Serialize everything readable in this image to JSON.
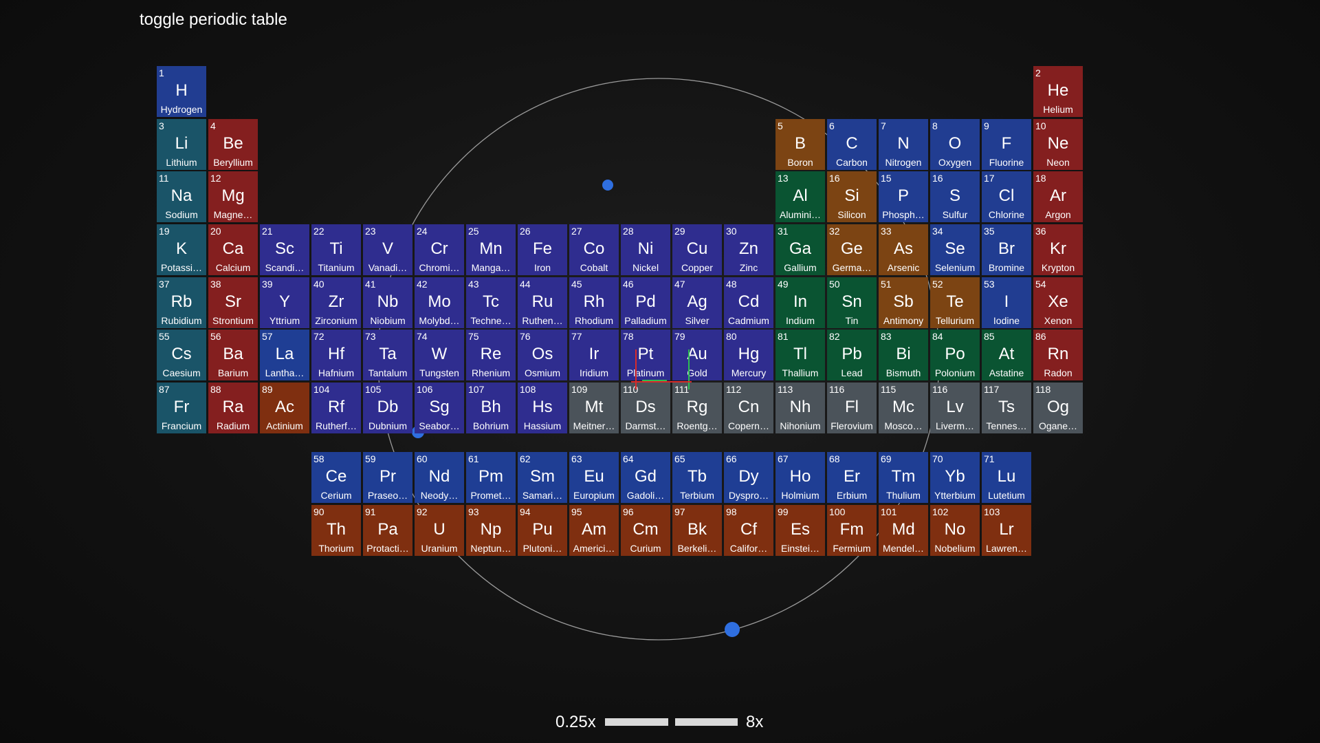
{
  "toggle_label": "toggle periodic table",
  "zoom": {
    "min_label": "0.25x",
    "max_label": "8x"
  },
  "colors": {
    "alkali": "#1a5468",
    "alkaline_earth": "#841f1f",
    "transition": "#2f2d8f",
    "lanthanide": "#1f3e94",
    "actinide": "#7f2f10",
    "metalloid": "#7c4413",
    "post_transition": "#0a5432",
    "nonmetal": "#213d91",
    "noble_gas": "#841f1f",
    "unknown": "#4b535a",
    "hydrogen": "#213d91",
    "orbit_line": "#9a9a9a",
    "electron": "#2f6fe0"
  },
  "elements": [
    {
      "n": "1",
      "s": "H",
      "name": "Hydrogen",
      "row": 1,
      "col": 1,
      "cat": "hydrogen"
    },
    {
      "n": "2",
      "s": "He",
      "name": "Helium",
      "row": 1,
      "col": 18,
      "cat": "noble_gas"
    },
    {
      "n": "3",
      "s": "Li",
      "name": "Lithium",
      "row": 2,
      "col": 1,
      "cat": "alkali"
    },
    {
      "n": "4",
      "s": "Be",
      "name": "Beryllium",
      "row": 2,
      "col": 2,
      "cat": "alkaline_earth"
    },
    {
      "n": "5",
      "s": "B",
      "name": "Boron",
      "row": 2,
      "col": 13,
      "cat": "metalloid"
    },
    {
      "n": "6",
      "s": "C",
      "name": "Carbon",
      "row": 2,
      "col": 14,
      "cat": "nonmetal"
    },
    {
      "n": "7",
      "s": "N",
      "name": "Nitrogen",
      "row": 2,
      "col": 15,
      "cat": "nonmetal"
    },
    {
      "n": "8",
      "s": "O",
      "name": "Oxygen",
      "row": 2,
      "col": 16,
      "cat": "nonmetal"
    },
    {
      "n": "9",
      "s": "F",
      "name": "Fluorine",
      "row": 2,
      "col": 17,
      "cat": "nonmetal"
    },
    {
      "n": "10",
      "s": "Ne",
      "name": "Neon",
      "row": 2,
      "col": 18,
      "cat": "noble_gas"
    },
    {
      "n": "11",
      "s": "Na",
      "name": "Sodium",
      "row": 3,
      "col": 1,
      "cat": "alkali"
    },
    {
      "n": "12",
      "s": "Mg",
      "name": "Magne…",
      "row": 3,
      "col": 2,
      "cat": "alkaline_earth"
    },
    {
      "n": "13",
      "s": "Al",
      "name": "Alumini…",
      "row": 3,
      "col": 13,
      "cat": "post_transition"
    },
    {
      "n": "16",
      "s": "Si",
      "name": "Silicon",
      "row": 3,
      "col": 14,
      "cat": "metalloid"
    },
    {
      "n": "15",
      "s": "P",
      "name": "Phosph…",
      "row": 3,
      "col": 15,
      "cat": "nonmetal"
    },
    {
      "n": "16",
      "s": "S",
      "name": "Sulfur",
      "row": 3,
      "col": 16,
      "cat": "nonmetal"
    },
    {
      "n": "17",
      "s": "Cl",
      "name": "Chlorine",
      "row": 3,
      "col": 17,
      "cat": "nonmetal"
    },
    {
      "n": "18",
      "s": "Ar",
      "name": "Argon",
      "row": 3,
      "col": 18,
      "cat": "noble_gas"
    },
    {
      "n": "19",
      "s": "K",
      "name": "Potassi…",
      "row": 4,
      "col": 1,
      "cat": "alkali"
    },
    {
      "n": "20",
      "s": "Ca",
      "name": "Calcium",
      "row": 4,
      "col": 2,
      "cat": "alkaline_earth"
    },
    {
      "n": "21",
      "s": "Sc",
      "name": "Scandi…",
      "row": 4,
      "col": 3,
      "cat": "transition"
    },
    {
      "n": "22",
      "s": "Ti",
      "name": "Titanium",
      "row": 4,
      "col": 4,
      "cat": "transition"
    },
    {
      "n": "23",
      "s": "V",
      "name": "Vanadi…",
      "row": 4,
      "col": 5,
      "cat": "transition"
    },
    {
      "n": "24",
      "s": "Cr",
      "name": "Chromi…",
      "row": 4,
      "col": 6,
      "cat": "transition"
    },
    {
      "n": "25",
      "s": "Mn",
      "name": "Manga…",
      "row": 4,
      "col": 7,
      "cat": "transition"
    },
    {
      "n": "26",
      "s": "Fe",
      "name": "Iron",
      "row": 4,
      "col": 8,
      "cat": "transition"
    },
    {
      "n": "27",
      "s": "Co",
      "name": "Cobalt",
      "row": 4,
      "col": 9,
      "cat": "transition"
    },
    {
      "n": "28",
      "s": "Ni",
      "name": "Nickel",
      "row": 4,
      "col": 10,
      "cat": "transition"
    },
    {
      "n": "29",
      "s": "Cu",
      "name": "Copper",
      "row": 4,
      "col": 11,
      "cat": "transition"
    },
    {
      "n": "30",
      "s": "Zn",
      "name": "Zinc",
      "row": 4,
      "col": 12,
      "cat": "transition"
    },
    {
      "n": "31",
      "s": "Ga",
      "name": "Gallium",
      "row": 4,
      "col": 13,
      "cat": "post_transition"
    },
    {
      "n": "32",
      "s": "Ge",
      "name": "Germa…",
      "row": 4,
      "col": 14,
      "cat": "metalloid"
    },
    {
      "n": "33",
      "s": "As",
      "name": "Arsenic",
      "row": 4,
      "col": 15,
      "cat": "metalloid"
    },
    {
      "n": "34",
      "s": "Se",
      "name": "Selenium",
      "row": 4,
      "col": 16,
      "cat": "nonmetal"
    },
    {
      "n": "35",
      "s": "Br",
      "name": "Bromine",
      "row": 4,
      "col": 17,
      "cat": "nonmetal"
    },
    {
      "n": "36",
      "s": "Kr",
      "name": "Krypton",
      "row": 4,
      "col": 18,
      "cat": "noble_gas"
    },
    {
      "n": "37",
      "s": "Rb",
      "name": "Rubidium",
      "row": 5,
      "col": 1,
      "cat": "alkali"
    },
    {
      "n": "38",
      "s": "Sr",
      "name": "Strontium",
      "row": 5,
      "col": 2,
      "cat": "alkaline_earth"
    },
    {
      "n": "39",
      "s": "Y",
      "name": "Yttrium",
      "row": 5,
      "col": 3,
      "cat": "transition"
    },
    {
      "n": "40",
      "s": "Zr",
      "name": "Zirconium",
      "row": 5,
      "col": 4,
      "cat": "transition"
    },
    {
      "n": "41",
      "s": "Nb",
      "name": "Niobium",
      "row": 5,
      "col": 5,
      "cat": "transition"
    },
    {
      "n": "42",
      "s": "Mo",
      "name": "Molybd…",
      "row": 5,
      "col": 6,
      "cat": "transition"
    },
    {
      "n": "43",
      "s": "Tc",
      "name": "Techne…",
      "row": 5,
      "col": 7,
      "cat": "transition"
    },
    {
      "n": "44",
      "s": "Ru",
      "name": "Ruthen…",
      "row": 5,
      "col": 8,
      "cat": "transition"
    },
    {
      "n": "45",
      "s": "Rh",
      "name": "Rhodium",
      "row": 5,
      "col": 9,
      "cat": "transition"
    },
    {
      "n": "46",
      "s": "Pd",
      "name": "Palladium",
      "row": 5,
      "col": 10,
      "cat": "transition"
    },
    {
      "n": "47",
      "s": "Ag",
      "name": "Silver",
      "row": 5,
      "col": 11,
      "cat": "transition"
    },
    {
      "n": "48",
      "s": "Cd",
      "name": "Cadmium",
      "row": 5,
      "col": 12,
      "cat": "transition"
    },
    {
      "n": "49",
      "s": "In",
      "name": "Indium",
      "row": 5,
      "col": 13,
      "cat": "post_transition"
    },
    {
      "n": "50",
      "s": "Sn",
      "name": "Tin",
      "row": 5,
      "col": 14,
      "cat": "post_transition"
    },
    {
      "n": "51",
      "s": "Sb",
      "name": "Antimony",
      "row": 5,
      "col": 15,
      "cat": "metalloid"
    },
    {
      "n": "52",
      "s": "Te",
      "name": "Tellurium",
      "row": 5,
      "col": 16,
      "cat": "metalloid"
    },
    {
      "n": "53",
      "s": "I",
      "name": "Iodine",
      "row": 5,
      "col": 17,
      "cat": "nonmetal"
    },
    {
      "n": "54",
      "s": "Xe",
      "name": "Xenon",
      "row": 5,
      "col": 18,
      "cat": "noble_gas"
    },
    {
      "n": "55",
      "s": "Cs",
      "name": "Caesium",
      "row": 6,
      "col": 1,
      "cat": "alkali"
    },
    {
      "n": "56",
      "s": "Ba",
      "name": "Barium",
      "row": 6,
      "col": 2,
      "cat": "alkaline_earth"
    },
    {
      "n": "57",
      "s": "La",
      "name": "Lantha…",
      "row": 6,
      "col": 3,
      "cat": "lanthanide"
    },
    {
      "n": "72",
      "s": "Hf",
      "name": "Hafnium",
      "row": 6,
      "col": 4,
      "cat": "transition"
    },
    {
      "n": "73",
      "s": "Ta",
      "name": "Tantalum",
      "row": 6,
      "col": 5,
      "cat": "transition"
    },
    {
      "n": "74",
      "s": "W",
      "name": "Tungsten",
      "row": 6,
      "col": 6,
      "cat": "transition"
    },
    {
      "n": "75",
      "s": "Re",
      "name": "Rhenium",
      "row": 6,
      "col": 7,
      "cat": "transition"
    },
    {
      "n": "76",
      "s": "Os",
      "name": "Osmium",
      "row": 6,
      "col": 8,
      "cat": "transition"
    },
    {
      "n": "77",
      "s": "Ir",
      "name": "Iridium",
      "row": 6,
      "col": 9,
      "cat": "transition"
    },
    {
      "n": "78",
      "s": "Pt",
      "name": "Platinum",
      "row": 6,
      "col": 10,
      "cat": "transition"
    },
    {
      "n": "79",
      "s": "Au",
      "name": "Gold",
      "row": 6,
      "col": 11,
      "cat": "transition"
    },
    {
      "n": "80",
      "s": "Hg",
      "name": "Mercury",
      "row": 6,
      "col": 12,
      "cat": "transition"
    },
    {
      "n": "81",
      "s": "Tl",
      "name": "Thallium",
      "row": 6,
      "col": 13,
      "cat": "post_transition"
    },
    {
      "n": "82",
      "s": "Pb",
      "name": "Lead",
      "row": 6,
      "col": 14,
      "cat": "post_transition"
    },
    {
      "n": "83",
      "s": "Bi",
      "name": "Bismuth",
      "row": 6,
      "col": 15,
      "cat": "post_transition"
    },
    {
      "n": "84",
      "s": "Po",
      "name": "Polonium",
      "row": 6,
      "col": 16,
      "cat": "post_transition"
    },
    {
      "n": "85",
      "s": "At",
      "name": "Astatine",
      "row": 6,
      "col": 17,
      "cat": "post_transition"
    },
    {
      "n": "86",
      "s": "Rn",
      "name": "Radon",
      "row": 6,
      "col": 18,
      "cat": "noble_gas"
    },
    {
      "n": "87",
      "s": "Fr",
      "name": "Francium",
      "row": 7,
      "col": 1,
      "cat": "alkali"
    },
    {
      "n": "88",
      "s": "Ra",
      "name": "Radium",
      "row": 7,
      "col": 2,
      "cat": "alkaline_earth"
    },
    {
      "n": "89",
      "s": "Ac",
      "name": "Actinium",
      "row": 7,
      "col": 3,
      "cat": "actinide"
    },
    {
      "n": "104",
      "s": "Rf",
      "name": "Rutherf…",
      "row": 7,
      "col": 4,
      "cat": "transition"
    },
    {
      "n": "105",
      "s": "Db",
      "name": "Dubnium",
      "row": 7,
      "col": 5,
      "cat": "transition"
    },
    {
      "n": "106",
      "s": "Sg",
      "name": "Seabor…",
      "row": 7,
      "col": 6,
      "cat": "transition"
    },
    {
      "n": "107",
      "s": "Bh",
      "name": "Bohrium",
      "row": 7,
      "col": 7,
      "cat": "transition"
    },
    {
      "n": "108",
      "s": "Hs",
      "name": "Hassium",
      "row": 7,
      "col": 8,
      "cat": "transition"
    },
    {
      "n": "109",
      "s": "Mt",
      "name": "Meitner…",
      "row": 7,
      "col": 9,
      "cat": "unknown"
    },
    {
      "n": "110",
      "s": "Ds",
      "name": "Darmst…",
      "row": 7,
      "col": 10,
      "cat": "unknown"
    },
    {
      "n": "111",
      "s": "Rg",
      "name": "Roentg…",
      "row": 7,
      "col": 11,
      "cat": "unknown"
    },
    {
      "n": "112",
      "s": "Cn",
      "name": "Copern…",
      "row": 7,
      "col": 12,
      "cat": "unknown"
    },
    {
      "n": "113",
      "s": "Nh",
      "name": "Nihonium",
      "row": 7,
      "col": 13,
      "cat": "unknown"
    },
    {
      "n": "116",
      "s": "Fl",
      "name": "Flerovium",
      "row": 7,
      "col": 14,
      "cat": "unknown"
    },
    {
      "n": "115",
      "s": "Mc",
      "name": "Mosco…",
      "row": 7,
      "col": 15,
      "cat": "unknown"
    },
    {
      "n": "116",
      "s": "Lv",
      "name": "Liverm…",
      "row": 7,
      "col": 16,
      "cat": "unknown"
    },
    {
      "n": "117",
      "s": "Ts",
      "name": "Tennes…",
      "row": 7,
      "col": 17,
      "cat": "unknown"
    },
    {
      "n": "118",
      "s": "Og",
      "name": "Ogane…",
      "row": 7,
      "col": 18,
      "cat": "unknown"
    },
    {
      "n": "58",
      "s": "Ce",
      "name": "Cerium",
      "row": 9,
      "col": 4,
      "cat": "lanthanide"
    },
    {
      "n": "59",
      "s": "Pr",
      "name": "Praseo…",
      "row": 9,
      "col": 5,
      "cat": "lanthanide"
    },
    {
      "n": "60",
      "s": "Nd",
      "name": "Neody…",
      "row": 9,
      "col": 6,
      "cat": "lanthanide"
    },
    {
      "n": "61",
      "s": "Pm",
      "name": "Promet…",
      "row": 9,
      "col": 7,
      "cat": "lanthanide"
    },
    {
      "n": "62",
      "s": "Sm",
      "name": "Samari…",
      "row": 9,
      "col": 8,
      "cat": "lanthanide"
    },
    {
      "n": "63",
      "s": "Eu",
      "name": "Europium",
      "row": 9,
      "col": 9,
      "cat": "lanthanide"
    },
    {
      "n": "64",
      "s": "Gd",
      "name": "Gadoli…",
      "row": 9,
      "col": 10,
      "cat": "lanthanide"
    },
    {
      "n": "65",
      "s": "Tb",
      "name": "Terbium",
      "row": 9,
      "col": 11,
      "cat": "lanthanide"
    },
    {
      "n": "66",
      "s": "Dy",
      "name": "Dyspro…",
      "row": 9,
      "col": 12,
      "cat": "lanthanide"
    },
    {
      "n": "67",
      "s": "Ho",
      "name": "Holmium",
      "row": 9,
      "col": 13,
      "cat": "lanthanide"
    },
    {
      "n": "68",
      "s": "Er",
      "name": "Erbium",
      "row": 9,
      "col": 14,
      "cat": "lanthanide"
    },
    {
      "n": "69",
      "s": "Tm",
      "name": "Thulium",
      "row": 9,
      "col": 15,
      "cat": "lanthanide"
    },
    {
      "n": "70",
      "s": "Yb",
      "name": "Ytterbium",
      "row": 9,
      "col": 16,
      "cat": "lanthanide"
    },
    {
      "n": "71",
      "s": "Lu",
      "name": "Lutetium",
      "row": 9,
      "col": 17,
      "cat": "lanthanide"
    },
    {
      "n": "90",
      "s": "Th",
      "name": "Thorium",
      "row": 10,
      "col": 4,
      "cat": "actinide"
    },
    {
      "n": "91",
      "s": "Pa",
      "name": "Protacti…",
      "row": 10,
      "col": 5,
      "cat": "actinide"
    },
    {
      "n": "92",
      "s": "U",
      "name": "Uranium",
      "row": 10,
      "col": 6,
      "cat": "actinide"
    },
    {
      "n": "93",
      "s": "Np",
      "name": "Neptun…",
      "row": 10,
      "col": 7,
      "cat": "actinide"
    },
    {
      "n": "94",
      "s": "Pu",
      "name": "Plutoni…",
      "row": 10,
      "col": 8,
      "cat": "actinide"
    },
    {
      "n": "95",
      "s": "Am",
      "name": "Americi…",
      "row": 10,
      "col": 9,
      "cat": "actinide"
    },
    {
      "n": "96",
      "s": "Cm",
      "name": "Curium",
      "row": 10,
      "col": 10,
      "cat": "actinide"
    },
    {
      "n": "97",
      "s": "Bk",
      "name": "Berkeli…",
      "row": 10,
      "col": 11,
      "cat": "actinide"
    },
    {
      "n": "98",
      "s": "Cf",
      "name": "Califor…",
      "row": 10,
      "col": 12,
      "cat": "actinide"
    },
    {
      "n": "99",
      "s": "Es",
      "name": "Einstei…",
      "row": 10,
      "col": 13,
      "cat": "actinide"
    },
    {
      "n": "100",
      "s": "Fm",
      "name": "Fermium",
      "row": 10,
      "col": 14,
      "cat": "actinide"
    },
    {
      "n": "101",
      "s": "Md",
      "name": "Mendel…",
      "row": 10,
      "col": 15,
      "cat": "actinide"
    },
    {
      "n": "102",
      "s": "No",
      "name": "Nobelium",
      "row": 10,
      "col": 16,
      "cat": "actinide"
    },
    {
      "n": "103",
      "s": "Lr",
      "name": "Lawren…",
      "row": 10,
      "col": 17,
      "cat": "actinide"
    }
  ]
}
